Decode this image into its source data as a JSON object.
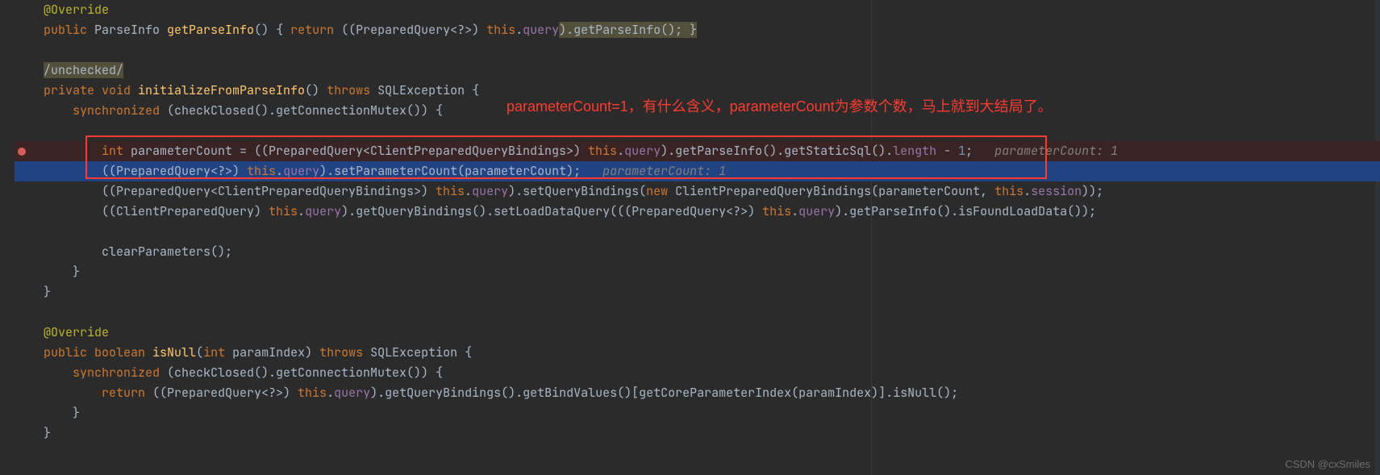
{
  "annotation": "parameterCount=1，有什么含义，parameterCount为参数个数，马上就到大结局了。",
  "watermark": "CSDN @cxSmiles",
  "lines": {
    "l1_anno": "@Override",
    "l2_kw1": "public ",
    "l2_type": "ParseInfo ",
    "l2_meth": "getParseInfo",
    "l2_p1": "() { ",
    "l2_kw2": "return ",
    "l2_p2": "((PreparedQuery<?>) ",
    "l2_kw3": "this",
    "l2_p3": ".",
    "l2_f1": "query",
    "l2_p4": ").getParseInfo(); }",
    "l3_warn": "/unchecked/",
    "l4_kw1": "private void ",
    "l4_meth": "initializeFromParseInfo",
    "l4_p1": "() ",
    "l4_kw2": "throws ",
    "l4_type": "SQLException ",
    "l4_p2": "{",
    "l5_kw1": "synchronized ",
    "l5_p1": "(checkClosed().getConnectionMutex()) {",
    "l6_kw1": "int ",
    "l6_var": "parameterCount = ((PreparedQuery<ClientPreparedQueryBindings>) ",
    "l6_kw2": "this",
    "l6_p1": ".",
    "l6_f1": "query",
    "l6_p2": ").getParseInfo().getStaticSql().",
    "l6_f2": "length",
    "l6_p3": " - ",
    "l6_num": "1",
    "l6_p4": ";   ",
    "l6_hint": "parameterCount: 1",
    "l7_p1": "((PreparedQuery<?>) ",
    "l7_kw1": "this",
    "l7_p2": ".",
    "l7_f1": "query",
    "l7_p3": ").setParameterCount(parameterCount);   ",
    "l7_hint": "parameterCount: 1",
    "l8_p1": "((PreparedQuery<ClientPreparedQueryBindings>) ",
    "l8_kw1": "this",
    "l8_p2": ".",
    "l8_f1": "query",
    "l8_p3": ").setQueryBindings(",
    "l8_kw2": "new ",
    "l8_type": "ClientPreparedQueryBindings(parameterCount, ",
    "l8_kw3": "this",
    "l8_p4": ".",
    "l8_f2": "session",
    "l8_p5": "));",
    "l9_p1": "((ClientPreparedQuery) ",
    "l9_kw1": "this",
    "l9_p2": ".",
    "l9_f1": "query",
    "l9_p3": ").getQueryBindings().setLoadDataQuery(((PreparedQuery<?>) ",
    "l9_kw2": "this",
    "l9_p4": ".",
    "l9_f2": "query",
    "l9_p5": ").getParseInfo().isFoundLoadData());",
    "l10_p1": "clearParameters();",
    "l11_p1": "}",
    "l12_p1": "}",
    "l13_anno": "@Override",
    "l14_kw1": "public boolean ",
    "l14_meth": "isNull",
    "l14_p1": "(",
    "l14_kw2": "int ",
    "l14_var": "paramIndex) ",
    "l14_kw3": "throws ",
    "l14_type": "SQLException ",
    "l14_p2": "{",
    "l15_kw1": "synchronized ",
    "l15_p1": "(checkClosed().getConnectionMutex()) {",
    "l16_kw1": "return ",
    "l16_p1": "((PreparedQuery<?>) ",
    "l16_kw2": "this",
    "l16_p2": ".",
    "l16_f1": "query",
    "l16_p3": ").getQueryBindings().getBindValues()[getCoreParameterIndex(paramIndex)].isNull();",
    "l17_p1": "}",
    "l18_p1": "}"
  }
}
